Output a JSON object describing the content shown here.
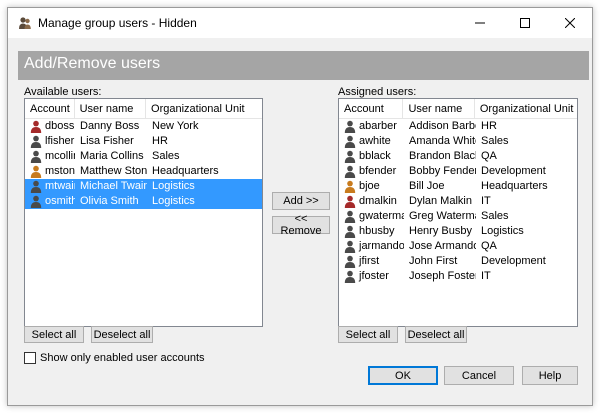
{
  "window": {
    "title": "Manage group users - Hidden",
    "minimize_icon": "minimize-icon",
    "maximize_icon": "maximize-icon",
    "close_icon": "close-icon"
  },
  "header": {
    "title": "Add/Remove users"
  },
  "available": {
    "label": "Available users:",
    "columns": [
      "Account",
      "User name",
      "Organizational Unit"
    ],
    "rows": [
      {
        "account": "dboss",
        "name": "Danny Boss",
        "ou": "New York",
        "icon_color": "#a52a2a",
        "selected": false
      },
      {
        "account": "lfisher",
        "name": "Lisa Fisher",
        "ou": "HR",
        "icon_color": "#4a4a4a",
        "selected": false
      },
      {
        "account": "mcollins",
        "name": "Maria Collins",
        "ou": "Sales",
        "icon_color": "#4a4a4a",
        "selected": false
      },
      {
        "account": "mstone",
        "name": "Matthew Stone",
        "ou": "Headquarters",
        "icon_color": "#c87b1e",
        "selected": false
      },
      {
        "account": "mtwain",
        "name": "Michael Twain",
        "ou": "Logistics",
        "icon_color": "#4a4a4a",
        "selected": true
      },
      {
        "account": "osmith",
        "name": "Olivia Smith",
        "ou": "Logistics",
        "icon_color": "#4a4a4a",
        "selected": true
      }
    ],
    "select_all": "Select all",
    "deselect_all": "Deselect all"
  },
  "assigned": {
    "label": "Assigned users:",
    "columns": [
      "Account",
      "User name",
      "Organizational Unit"
    ],
    "rows": [
      {
        "account": "abarber",
        "name": "Addison Barber",
        "ou": "HR",
        "icon_color": "#4a4a4a"
      },
      {
        "account": "awhite",
        "name": "Amanda White",
        "ou": "Sales",
        "icon_color": "#4a4a4a"
      },
      {
        "account": "bblack",
        "name": "Brandon Black",
        "ou": "QA",
        "icon_color": "#4a4a4a"
      },
      {
        "account": "bfender",
        "name": "Bobby Fender",
        "ou": "Development",
        "icon_color": "#4a4a4a"
      },
      {
        "account": "bjoe",
        "name": "Bill Joe",
        "ou": "Headquarters",
        "icon_color": "#c87b1e"
      },
      {
        "account": "dmalkin",
        "name": "Dylan Malkin",
        "ou": "IT",
        "icon_color": "#a52a2a"
      },
      {
        "account": "gwaterman",
        "name": "Greg Waterman",
        "ou": "Sales",
        "icon_color": "#4a4a4a"
      },
      {
        "account": "hbusby",
        "name": "Henry Busby",
        "ou": "Logistics",
        "icon_color": "#4a4a4a"
      },
      {
        "account": "jarmando",
        "name": "Jose Armando",
        "ou": "QA",
        "icon_color": "#4a4a4a"
      },
      {
        "account": "jfirst",
        "name": "John First",
        "ou": "Development",
        "icon_color": "#4a4a4a"
      },
      {
        "account": "jfoster",
        "name": "Joseph Foster",
        "ou": "IT",
        "icon_color": "#4a4a4a"
      }
    ],
    "select_all": "Select all",
    "deselect_all": "Deselect all"
  },
  "actions": {
    "add": "Add >>",
    "remove": "<< Remove"
  },
  "options": {
    "show_enabled_only": "Show only enabled user accounts",
    "show_enabled_only_checked": false
  },
  "footer": {
    "ok": "OK",
    "cancel": "Cancel",
    "help": "Help"
  },
  "colors": {
    "selection": "#3399ff",
    "header_band": "#a5a5a5",
    "accent": "#0078d7"
  }
}
